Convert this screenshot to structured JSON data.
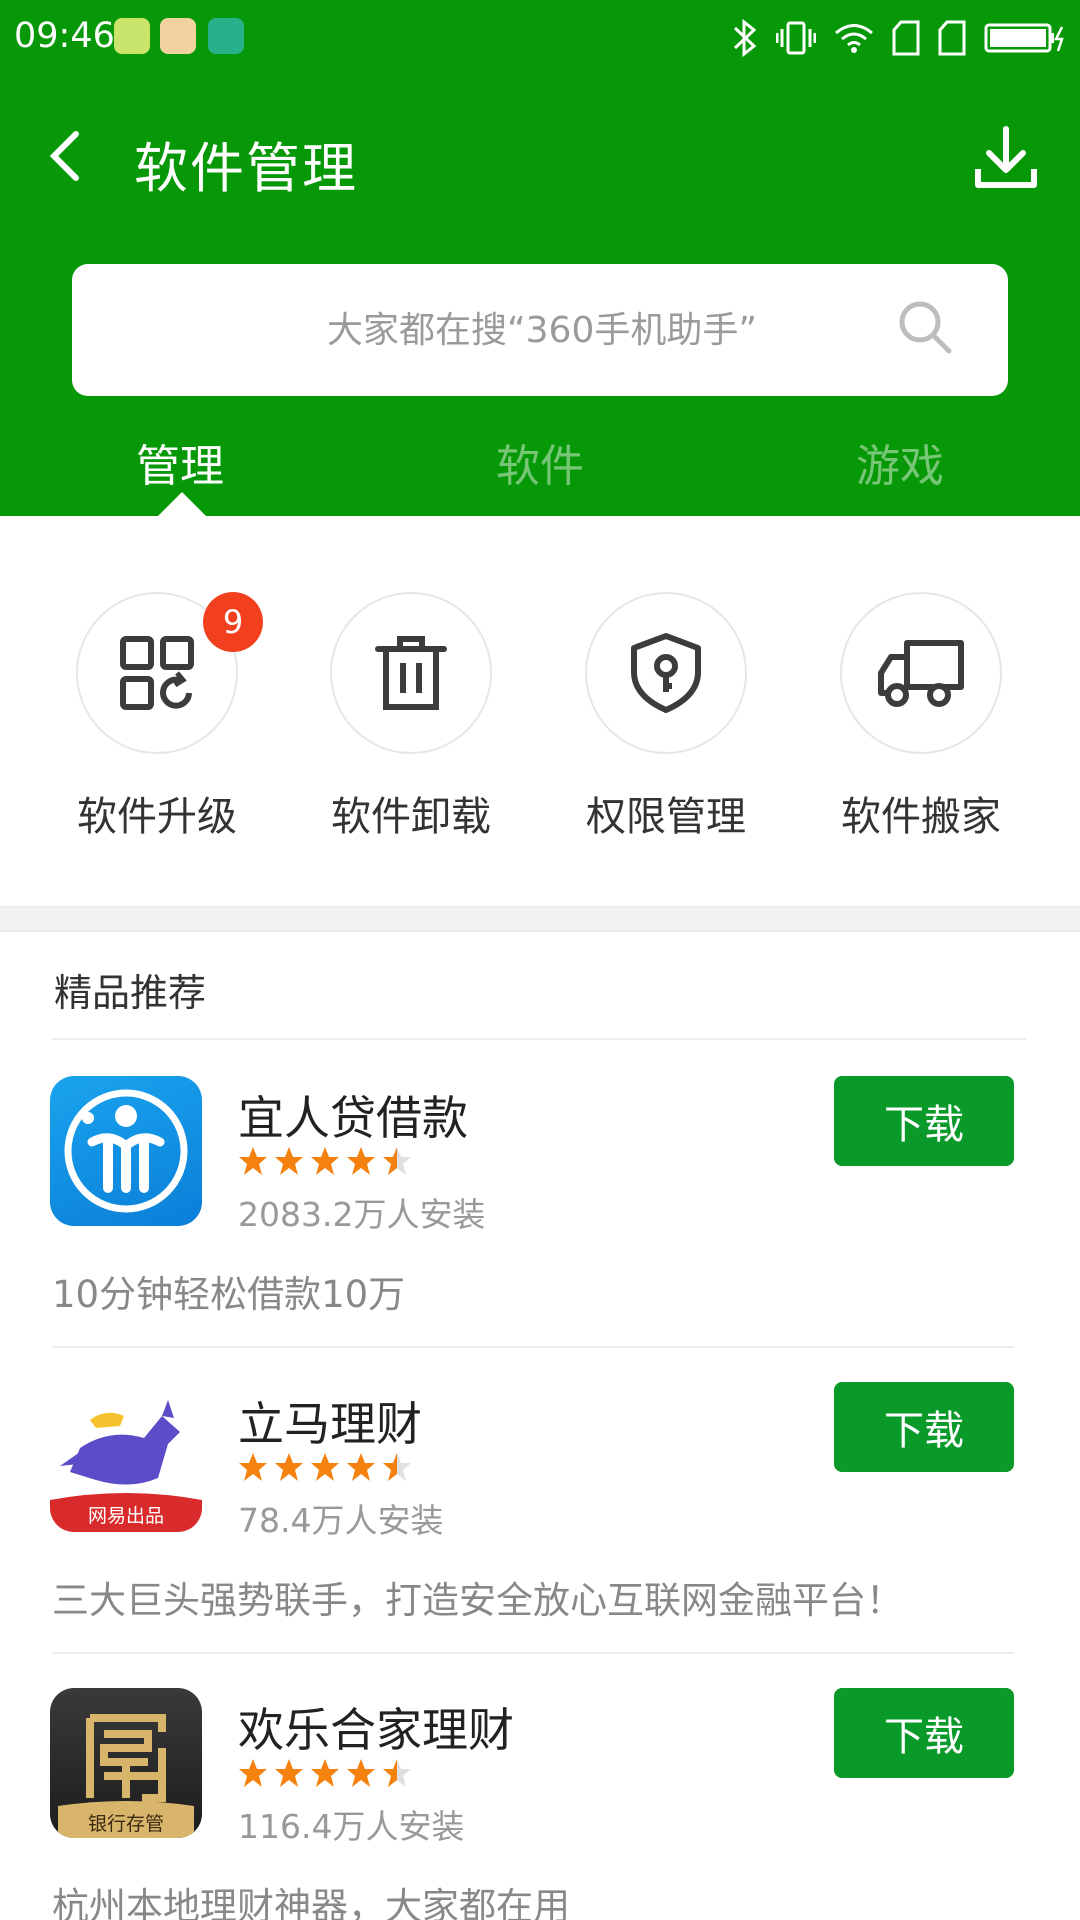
{
  "status_bar": {
    "time": "09:46"
  },
  "header": {
    "title": "软件管理"
  },
  "search": {
    "placeholder": "大家都在搜“360手机助手”"
  },
  "tabs": [
    {
      "label": "管理",
      "active": true
    },
    {
      "label": "软件",
      "active": false
    },
    {
      "label": "游戏",
      "active": false
    }
  ],
  "tools": [
    {
      "label": "软件升级",
      "icon": "app-update-icon",
      "badge": "9"
    },
    {
      "label": "软件卸载",
      "icon": "trash-icon"
    },
    {
      "label": "权限管理",
      "icon": "shield-key-icon"
    },
    {
      "label": "软件搬家",
      "icon": "truck-icon"
    }
  ],
  "recommend": {
    "title": "精品推荐",
    "download_label": "下载",
    "apps": [
      {
        "name": "宜人贷借款",
        "rating": 4.5,
        "installs": "2083.2万人安装",
        "desc": "10分钟轻松借款10万"
      },
      {
        "name": "立马理财",
        "rating": 4.5,
        "installs": "78.4万人安装",
        "desc": "三大巨头强势联手，打造安全放心互联网金融平台！",
        "icon_tag": "网易出品"
      },
      {
        "name": "欢乐合家理财",
        "rating": 4.5,
        "installs": "116.4万人安装",
        "desc": "杭州本地理财神器，大家都在用",
        "icon_tag": "银行存管"
      }
    ]
  },
  "colors": {
    "header_green": "#069807",
    "button_green": "#0a9a2a",
    "badge_red": "#f2401f",
    "star_orange": "#f5820f"
  }
}
